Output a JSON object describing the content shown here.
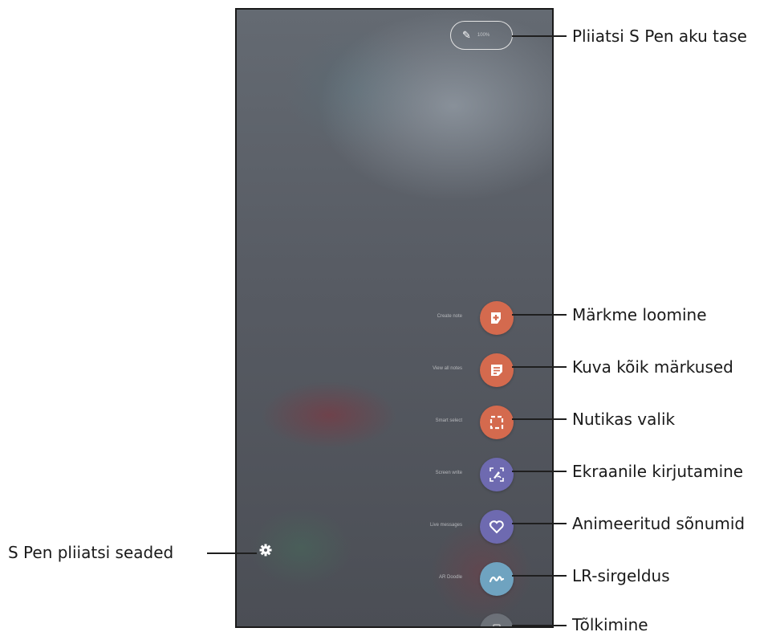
{
  "callouts": {
    "battery": "Pliiatsi S Pen aku tase",
    "create_note": "Märkme loomine",
    "view_all_notes": "Kuva kõik märkused",
    "smart_select": "Nutikas valik",
    "screen_write": "Ekraanile kirjutamine",
    "live_messages": "Animeeritud sõnumid",
    "ar_doodle": "LR-sirgeldus",
    "translate": "Tõlkimine",
    "settings": "S Pen pliiatsi seaded"
  },
  "screen": {
    "battery_level": "100%",
    "menu": [
      {
        "label": "Create note",
        "icon": "note-plus-icon",
        "color": "#d46a4e"
      },
      {
        "label": "View all notes",
        "icon": "notes-list-icon",
        "color": "#d46a4e"
      },
      {
        "label": "Smart select",
        "icon": "smart-select-icon",
        "color": "#d46a4e"
      },
      {
        "label": "Screen write",
        "icon": "screen-write-icon",
        "color": "#6e6ab0"
      },
      {
        "label": "Live messages",
        "icon": "heart-message-icon",
        "color": "#6e6ab0"
      },
      {
        "label": "AR Doodle",
        "icon": "doodle-icon",
        "color": "#6fa3c0"
      },
      {
        "label": "",
        "icon": "translate-icon",
        "color": "#7a8088"
      }
    ],
    "settings_icon": "gear-icon"
  }
}
